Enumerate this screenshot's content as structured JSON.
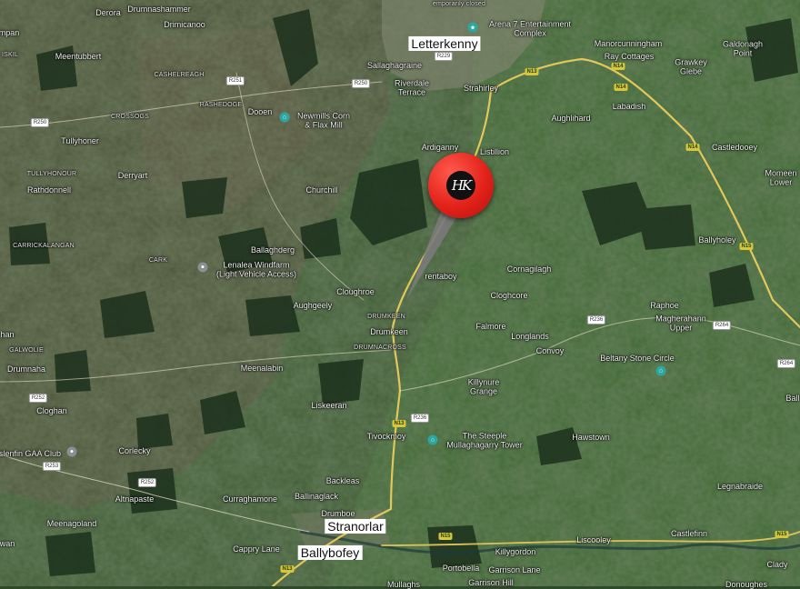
{
  "map": {
    "towns": [
      {
        "name": "Letterkenny"
      },
      {
        "name": "Stranorlar"
      },
      {
        "name": "Ballybofey"
      }
    ],
    "places": [
      "Derora",
      "Drumnashammer",
      "Drimicanoo",
      "mpan",
      "Meentubbert",
      "Sallaghagraine",
      "Riverdale\nTerrace",
      "Strahirley",
      "Manorcunningham",
      "Ray Cottages",
      "Galdonagh\nPoint",
      "Grawkey\nGlebe",
      "Labadish",
      "Aughlihard",
      "Dooen",
      "Tullyhoner",
      "Ardiganny",
      "Listillion",
      "Castledooey",
      "Momeen\nLower",
      "Derryart",
      "Rathdonnell",
      "Churchill",
      "Ballaghderg",
      "Ballyholey",
      "Cornagilagh",
      "rentaboy",
      "Cloughroe",
      "Aughgeely",
      "Cloghcore",
      "Raphoe",
      "Magherahann\nUpper",
      "Drumkeen",
      "Falmore",
      "Longlands",
      "Convoy",
      "Drumnaha",
      "Meenalabin",
      "han",
      "Killynure\nGrange",
      "Cloghan",
      "Liskeeran",
      "Tivockmoy",
      "Hawstown",
      "Corlecky",
      "Backleas",
      "Altnapaste",
      "Curraghamone",
      "Ballinaglack",
      "Legnabraide",
      "Drumboe",
      "Meenagoland",
      "Castlefinn",
      "Liscooley",
      "Killygordon",
      "Cappry Lane",
      "wan",
      "Portobella",
      "Garrison Lane",
      "Clady",
      "Ball",
      "Garrison Hill",
      "Donoughes",
      "Mullaghs"
    ],
    "small_labels": [
      "ISKIL",
      "CASHELREAGH",
      "RASHEDOGE",
      "CROSSOGS",
      "TULLYHONOUR",
      "CARRICKALANGAN",
      "CARK",
      "DRUMKEEN",
      "DRUMNACROSS",
      "GALWOLIE",
      "emporarily closed"
    ],
    "pois": [
      {
        "name": "Arena 7 Entertainment\nComplex",
        "icon": "entertainment-icon"
      },
      {
        "name": "Newmills Corn\n& Flax Mill",
        "icon": "landmark-icon"
      },
      {
        "name": "Lenalea Windfarm\n(Light Vehicle Access)",
        "icon": "place-icon"
      },
      {
        "name": "Beltany Stone Circle",
        "icon": "landmark-icon"
      },
      {
        "name": "The Steeple\nMullaghagarry Tower",
        "icon": "landmark-icon"
      },
      {
        "name": "slenfin GAA Club",
        "icon": "sports-icon"
      }
    ],
    "road_shields": [
      "R251",
      "R250",
      "R229",
      "N13",
      "N14",
      "N14",
      "N14",
      "R250",
      "R252",
      "R253",
      "R236",
      "N13",
      "R236",
      "R264",
      "R264",
      "N15",
      "N15",
      "N15",
      "N13",
      "R252"
    ],
    "pin": {
      "logo_text": "HK",
      "color": "#e3221a"
    },
    "colors": {
      "land": "#3b5a33",
      "forest": "#1f3420",
      "bog": "#5a5036",
      "road": "#e8d36a"
    }
  }
}
